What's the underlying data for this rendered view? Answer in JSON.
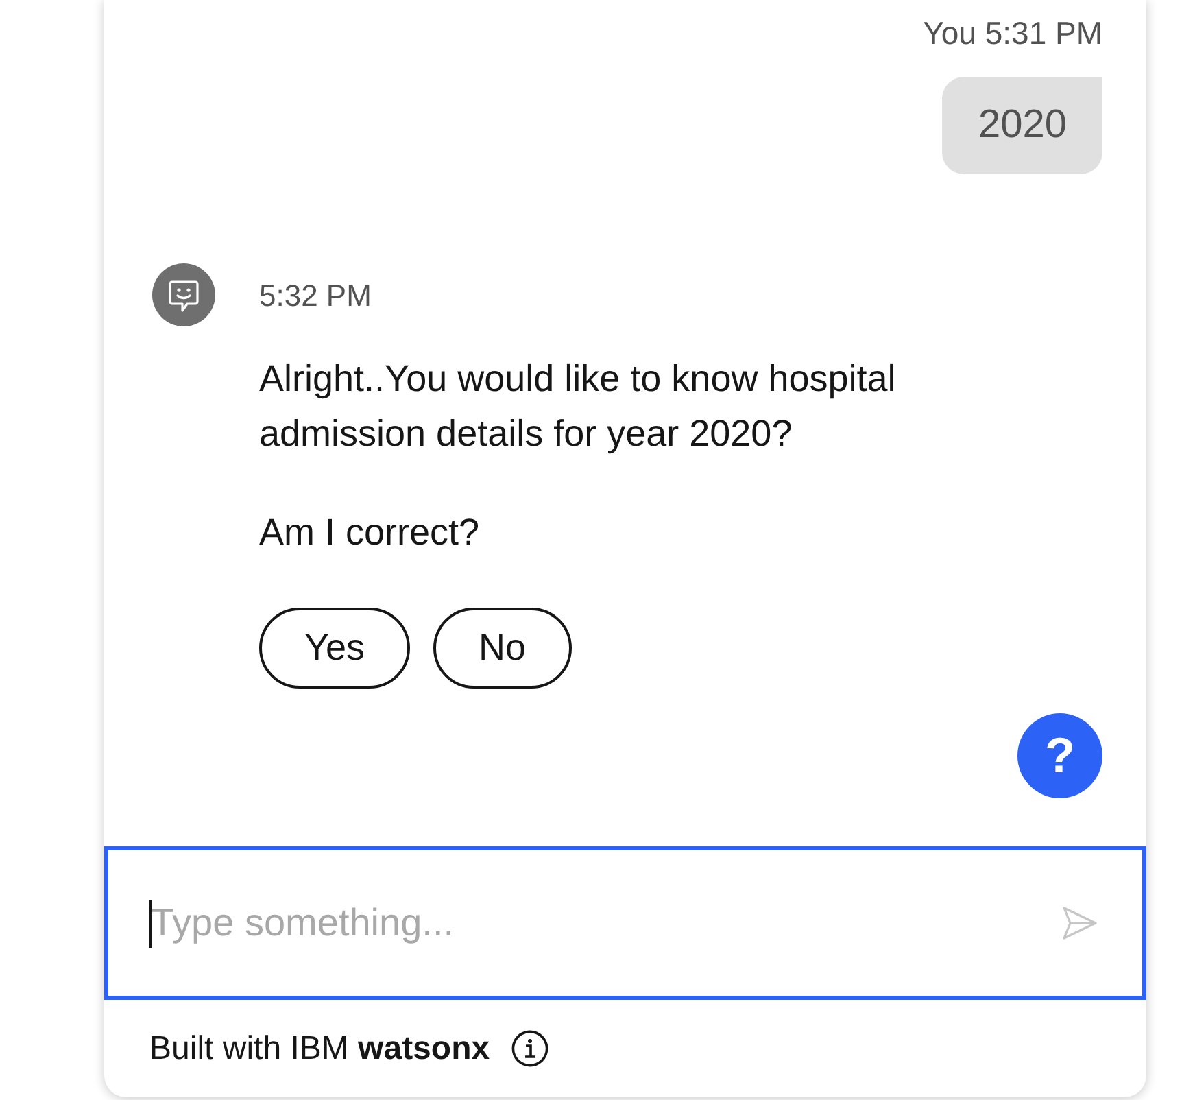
{
  "messages": [
    {
      "kind": "user",
      "meta": "You 5:31 PM",
      "text": "2020"
    },
    {
      "kind": "bot",
      "meta": "5:32 PM",
      "paragraphs": [
        "Alright..You would like to know hospital admission details for year 2020?",
        "Am I correct?"
      ],
      "options": [
        "Yes",
        "No"
      ]
    }
  ],
  "help_button": {
    "label": "?"
  },
  "composer": {
    "placeholder": "Type something...",
    "focused": true
  },
  "footer": {
    "text": "Built with IBM **watsonx**"
  }
}
